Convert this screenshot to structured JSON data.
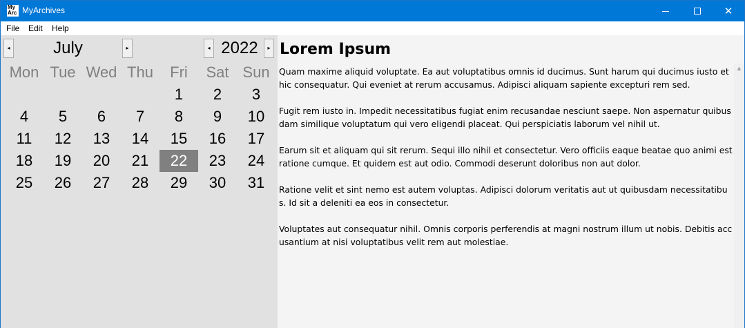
{
  "window": {
    "title": "MyArchives",
    "icon_text_1": "My",
    "icon_text_2": "Arc",
    "minimize_glyph": "minimize-icon",
    "maximize_glyph": "maximize-icon",
    "close_glyph": "✕"
  },
  "menu": {
    "items": [
      "File",
      "Edit",
      "Help"
    ]
  },
  "calendar": {
    "month": "July",
    "year": "2022",
    "prev_glyph": "◂",
    "next_glyph": "▸",
    "weekdays": [
      "Mon",
      "Tue",
      "Wed",
      "Thu",
      "Fri",
      "Sat",
      "Sun"
    ],
    "first_day_column": 4,
    "days_in_month": 31,
    "selected_day": 22,
    "colors": {
      "panel": "#e1e1e1",
      "selected": "#808080",
      "weekday": "#808080"
    }
  },
  "document": {
    "title": "Lorem Ipsum",
    "paragraphs": [
      "Quam maxime aliquid voluptate. Ea aut voluptatibus omnis id ducimus. Sunt harum qui ducimus iusto et hic consequatur. Qui eveniet at rerum accusamus. Adipisci aliquam sapiente excepturi rem sed.",
      "Fugit rem iusto in. Impedit necessitatibus fugiat enim recusandae nesciunt saepe. Non aspernatur quibusdam similique voluptatum qui vero eligendi placeat. Qui perspiciatis laborum vel nihil ut.",
      "Earum sit et aliquam qui sit rerum. Sequi illo nihil et consectetur. Vero officiis eaque beatae quo animi est ratione cumque. Et quidem est aut odio. Commodi deserunt doloribus non aut dolor.",
      "Ratione velit et sint nemo est autem voluptas. Adipisci dolorum veritatis aut ut quibusdam necessitatibus. Id sit a deleniti ea eos in consectetur.",
      "Voluptates aut consequatur nihil. Omnis corporis perferendis at magni nostrum illum ut nobis. Debitis accusantium at nisi voluptatibus velit rem aut molestiae."
    ]
  },
  "colors": {
    "titlebar": "#0078d7",
    "document_bg": "#f4f4f4"
  }
}
